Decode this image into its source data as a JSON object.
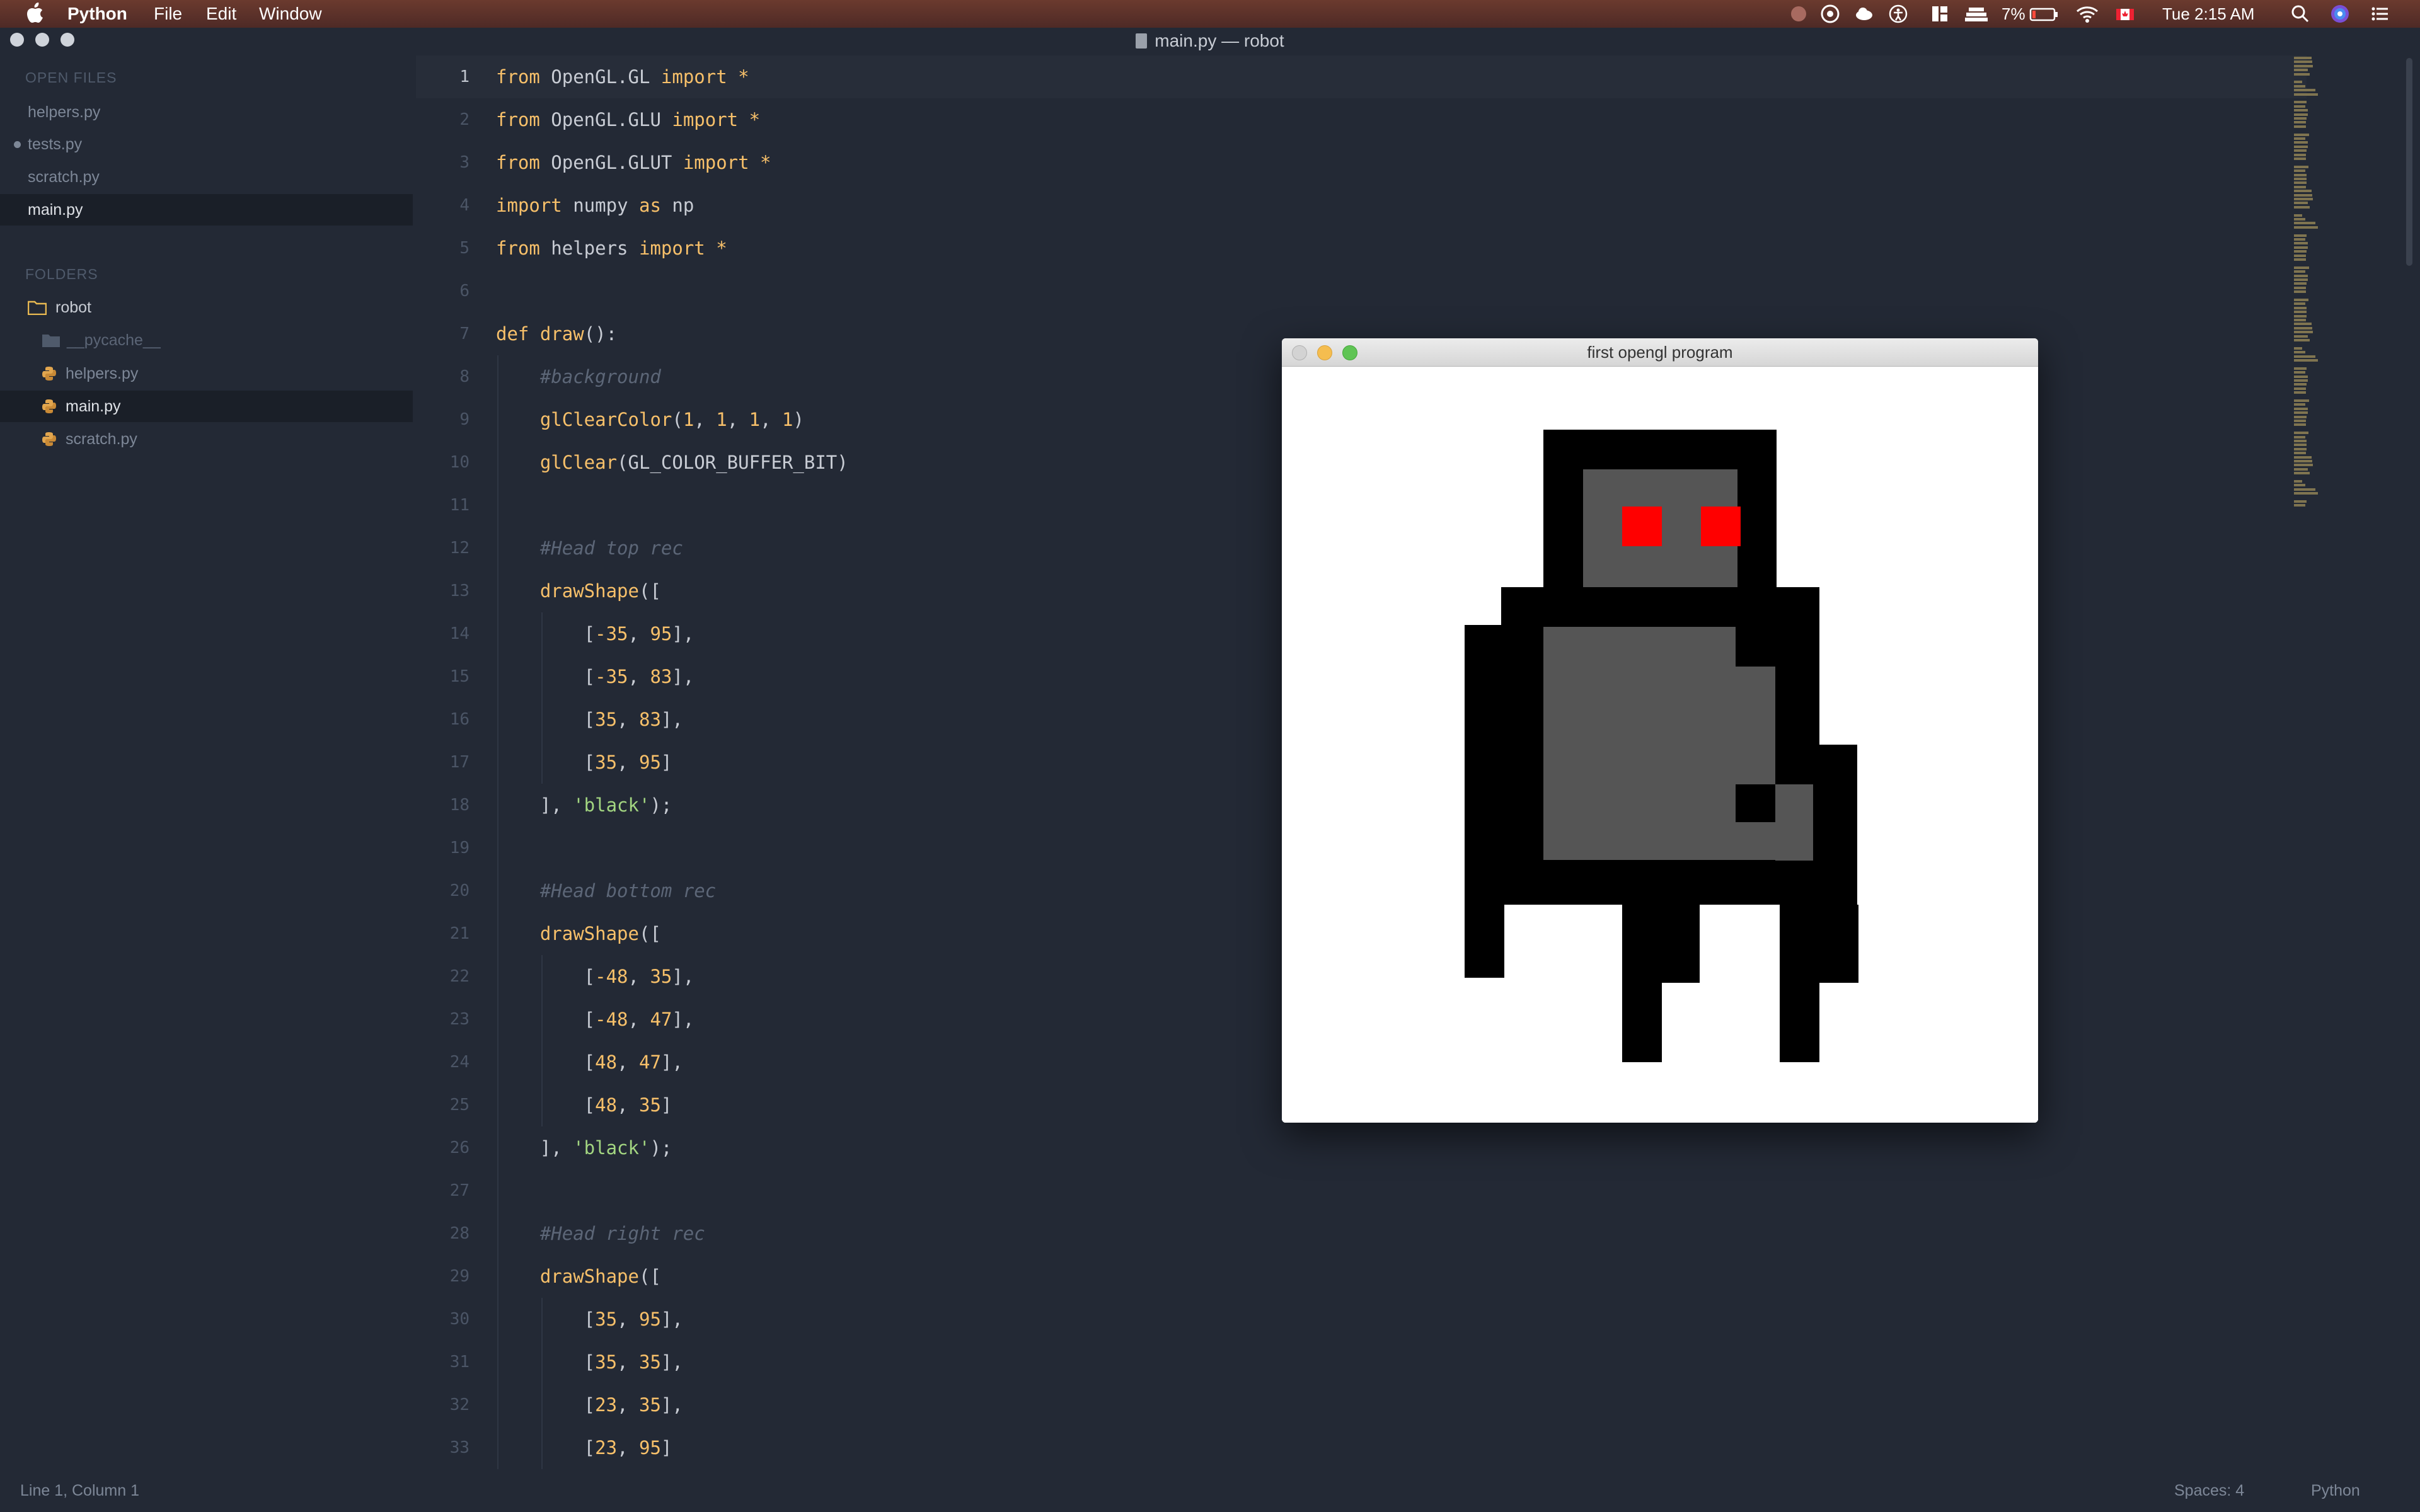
{
  "menubar": {
    "app_name": "Python",
    "items": [
      "File",
      "Edit",
      "Window"
    ],
    "battery": "7%",
    "clock": "Tue 2:15 AM"
  },
  "window": {
    "title": "main.py — robot"
  },
  "sidebar": {
    "open_files_heading": "OPEN FILES",
    "open_files": [
      {
        "name": "helpers.py"
      },
      {
        "name": "tests.py"
      },
      {
        "name": "scratch.py"
      },
      {
        "name": "main.py"
      }
    ],
    "folders_heading": "FOLDERS",
    "root_folder": "robot",
    "tree": [
      {
        "name": "__pycache__"
      },
      {
        "name": "helpers.py"
      },
      {
        "name": "main.py"
      },
      {
        "name": "scratch.py"
      }
    ]
  },
  "editor": {
    "lines": [
      [
        {
          "t": "from",
          "c": "kw"
        },
        {
          "t": " OpenGL.GL ",
          "c": "pl"
        },
        {
          "t": "import",
          "c": "kw"
        },
        {
          "t": " *",
          "c": "kw"
        }
      ],
      [
        {
          "t": "from",
          "c": "kw"
        },
        {
          "t": " OpenGL.GLU ",
          "c": "pl"
        },
        {
          "t": "import",
          "c": "kw"
        },
        {
          "t": " *",
          "c": "kw"
        }
      ],
      [
        {
          "t": "from",
          "c": "kw"
        },
        {
          "t": " OpenGL.GLUT ",
          "c": "pl"
        },
        {
          "t": "import",
          "c": "kw"
        },
        {
          "t": " *",
          "c": "kw"
        }
      ],
      [
        {
          "t": "import",
          "c": "kw"
        },
        {
          "t": " numpy ",
          "c": "pl"
        },
        {
          "t": "as",
          "c": "kw"
        },
        {
          "t": " np",
          "c": "pl"
        }
      ],
      [
        {
          "t": "from",
          "c": "kw"
        },
        {
          "t": " helpers ",
          "c": "pl"
        },
        {
          "t": "import",
          "c": "kw"
        },
        {
          "t": " *",
          "c": "kw"
        }
      ],
      [],
      [
        {
          "t": "def",
          "c": "kw"
        },
        {
          "t": " ",
          "c": "pl"
        },
        {
          "t": "draw",
          "c": "fn"
        },
        {
          "t": "():",
          "c": "pl"
        }
      ],
      [
        {
          "t": "    #background",
          "c": "cm"
        }
      ],
      [
        {
          "t": "    ",
          "c": "pl"
        },
        {
          "t": "glClearColor",
          "c": "fn"
        },
        {
          "t": "(",
          "c": "pl"
        },
        {
          "t": "1",
          "c": "num"
        },
        {
          "t": ", ",
          "c": "pl"
        },
        {
          "t": "1",
          "c": "num"
        },
        {
          "t": ", ",
          "c": "pl"
        },
        {
          "t": "1",
          "c": "num"
        },
        {
          "t": ", ",
          "c": "pl"
        },
        {
          "t": "1",
          "c": "num"
        },
        {
          "t": ")",
          "c": "pl"
        }
      ],
      [
        {
          "t": "    ",
          "c": "pl"
        },
        {
          "t": "glClear",
          "c": "fn"
        },
        {
          "t": "(GL_COLOR_BUFFER_BIT)",
          "c": "pl"
        }
      ],
      [],
      [
        {
          "t": "    #Head top rec",
          "c": "cm"
        }
      ],
      [
        {
          "t": "    ",
          "c": "pl"
        },
        {
          "t": "drawShape",
          "c": "fn"
        },
        {
          "t": "([",
          "c": "pl"
        }
      ],
      [
        {
          "t": "        [",
          "c": "pl"
        },
        {
          "t": "-35",
          "c": "num"
        },
        {
          "t": ", ",
          "c": "pl"
        },
        {
          "t": "95",
          "c": "num"
        },
        {
          "t": "],",
          "c": "pl"
        }
      ],
      [
        {
          "t": "        [",
          "c": "pl"
        },
        {
          "t": "-35",
          "c": "num"
        },
        {
          "t": ", ",
          "c": "pl"
        },
        {
          "t": "83",
          "c": "num"
        },
        {
          "t": "],",
          "c": "pl"
        }
      ],
      [
        {
          "t": "        [",
          "c": "pl"
        },
        {
          "t": "35",
          "c": "num"
        },
        {
          "t": ", ",
          "c": "pl"
        },
        {
          "t": "83",
          "c": "num"
        },
        {
          "t": "],",
          "c": "pl"
        }
      ],
      [
        {
          "t": "        [",
          "c": "pl"
        },
        {
          "t": "35",
          "c": "num"
        },
        {
          "t": ", ",
          "c": "pl"
        },
        {
          "t": "95",
          "c": "num"
        },
        {
          "t": "]",
          "c": "pl"
        }
      ],
      [
        {
          "t": "    ], ",
          "c": "pl"
        },
        {
          "t": "'black'",
          "c": "str"
        },
        {
          "t": ");",
          "c": "pl"
        }
      ],
      [],
      [
        {
          "t": "    #Head bottom rec",
          "c": "cm"
        }
      ],
      [
        {
          "t": "    ",
          "c": "pl"
        },
        {
          "t": "drawShape",
          "c": "fn"
        },
        {
          "t": "([",
          "c": "pl"
        }
      ],
      [
        {
          "t": "        [",
          "c": "pl"
        },
        {
          "t": "-48",
          "c": "num"
        },
        {
          "t": ", ",
          "c": "pl"
        },
        {
          "t": "35",
          "c": "num"
        },
        {
          "t": "],",
          "c": "pl"
        }
      ],
      [
        {
          "t": "        [",
          "c": "pl"
        },
        {
          "t": "-48",
          "c": "num"
        },
        {
          "t": ", ",
          "c": "pl"
        },
        {
          "t": "47",
          "c": "num"
        },
        {
          "t": "],",
          "c": "pl"
        }
      ],
      [
        {
          "t": "        [",
          "c": "pl"
        },
        {
          "t": "48",
          "c": "num"
        },
        {
          "t": ", ",
          "c": "pl"
        },
        {
          "t": "47",
          "c": "num"
        },
        {
          "t": "],",
          "c": "pl"
        }
      ],
      [
        {
          "t": "        [",
          "c": "pl"
        },
        {
          "t": "48",
          "c": "num"
        },
        {
          "t": ", ",
          "c": "pl"
        },
        {
          "t": "35",
          "c": "num"
        },
        {
          "t": "]",
          "c": "pl"
        }
      ],
      [
        {
          "t": "    ], ",
          "c": "pl"
        },
        {
          "t": "'black'",
          "c": "str"
        },
        {
          "t": ");",
          "c": "pl"
        }
      ],
      [],
      [
        {
          "t": "    #Head right rec",
          "c": "cm"
        }
      ],
      [
        {
          "t": "    ",
          "c": "pl"
        },
        {
          "t": "drawShape",
          "c": "fn"
        },
        {
          "t": "([",
          "c": "pl"
        }
      ],
      [
        {
          "t": "        [",
          "c": "pl"
        },
        {
          "t": "35",
          "c": "num"
        },
        {
          "t": ", ",
          "c": "pl"
        },
        {
          "t": "95",
          "c": "num"
        },
        {
          "t": "],",
          "c": "pl"
        }
      ],
      [
        {
          "t": "        [",
          "c": "pl"
        },
        {
          "t": "35",
          "c": "num"
        },
        {
          "t": ", ",
          "c": "pl"
        },
        {
          "t": "35",
          "c": "num"
        },
        {
          "t": "],",
          "c": "pl"
        }
      ],
      [
        {
          "t": "        [",
          "c": "pl"
        },
        {
          "t": "23",
          "c": "num"
        },
        {
          "t": ", ",
          "c": "pl"
        },
        {
          "t": "35",
          "c": "num"
        },
        {
          "t": "],",
          "c": "pl"
        }
      ],
      [
        {
          "t": "        [",
          "c": "pl"
        },
        {
          "t": "23",
          "c": "num"
        },
        {
          "t": ", ",
          "c": "pl"
        },
        {
          "t": "95",
          "c": "num"
        },
        {
          "t": "]",
          "c": "pl"
        }
      ]
    ]
  },
  "gl_window": {
    "title": "first opengl program",
    "colors": {
      "body": "#000000",
      "panel": "#555555",
      "eye": "#ff0000",
      "background": "#ffffff"
    }
  },
  "statusbar": {
    "position": "Line 1, Column 1",
    "indent": "Spaces: 4",
    "syntax": "Python"
  }
}
